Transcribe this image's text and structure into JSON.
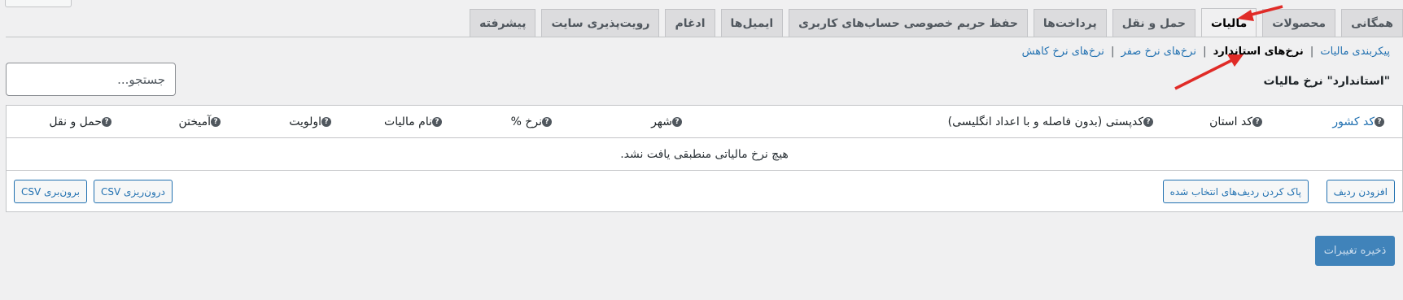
{
  "tabs": [
    {
      "label": "همگانی",
      "active": false
    },
    {
      "label": "محصولات",
      "active": false
    },
    {
      "label": "مالیات",
      "active": true
    },
    {
      "label": "حمل و نقل",
      "active": false
    },
    {
      "label": "پرداخت‌ها",
      "active": false
    },
    {
      "label": "حفظ حریم خصوصی حساب‌های کاربری",
      "active": false
    },
    {
      "label": "ایمیل‌ها",
      "active": false
    },
    {
      "label": "ادغام",
      "active": false
    },
    {
      "label": "رویت‌پذیری سایت",
      "active": false
    },
    {
      "label": "پیشرفته",
      "active": false
    }
  ],
  "subnav": {
    "tax_options": "پیکربندی مالیات",
    "standard_rates": "نرخ‌های استاندارد",
    "zero_rates": "نرخ‌های نرخ صفر",
    "reduced_rates": "نرخ‌های نرخ کاهش",
    "separator": "|"
  },
  "section_title": "\"استاندارد\" نرخ مالیات",
  "search": {
    "placeholder": "جستجو...",
    "value": ""
  },
  "table": {
    "columns": [
      {
        "label": "کد کشور",
        "help": "?"
      },
      {
        "label": "کد استان",
        "help": "?"
      },
      {
        "label": "کدپستی (بدون فاصله و با اعداد انگلیسی)",
        "help": "?"
      },
      {
        "label": "شهر",
        "help": "?"
      },
      {
        "label": "نرخ %",
        "help": "?"
      },
      {
        "label": "نام مالیات",
        "help": "?"
      },
      {
        "label": "اولویت",
        "help": "?"
      },
      {
        "label": "آمیختن",
        "help": "?"
      },
      {
        "label": "حمل و نقل",
        "help": "?"
      }
    ],
    "empty_message": "هیچ نرخ مالیاتی منطبقی یافت نشد."
  },
  "footer_buttons": {
    "add_row": "افزودن ردیف",
    "remove_selected": "پاک کردن ردیف‌های انتخاب شده",
    "import_csv": "درون‌ریزی CSV",
    "export_csv": "برون‌بری CSV"
  },
  "save_button": "ذخیره تغییرات",
  "colors": {
    "accent": "#2271b1",
    "annotation_arrow": "#e02b27"
  }
}
